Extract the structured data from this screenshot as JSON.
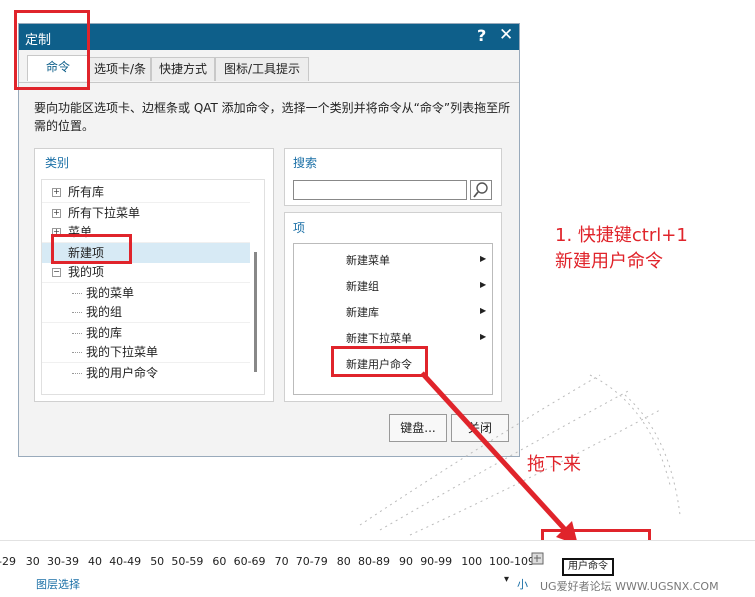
{
  "dialog": {
    "title": "定制",
    "help": "?",
    "close": "✕",
    "tabs": [
      "命令",
      "选项卡/条",
      "快捷方式",
      "图标/工具提示"
    ],
    "description": "要向功能区选项卡、边框条或 QAT 添加命令，选择一个类别并将命令从“命令”列表拖至所需的位置。",
    "category_title": "类别",
    "category_tree": [
      {
        "label": "所有库",
        "level": 0,
        "expander": "+"
      },
      {
        "label": "所有下拉菜单",
        "level": 0,
        "expander": "+"
      },
      {
        "label": "菜单",
        "level": 0,
        "expander": "+"
      },
      {
        "label": "新建项",
        "level": 0,
        "expander": ""
      },
      {
        "label": "我的项",
        "level": 0,
        "expander": "−"
      },
      {
        "label": "我的菜单",
        "level": 1,
        "expander": ""
      },
      {
        "label": "我的组",
        "level": 1,
        "expander": ""
      },
      {
        "label": "我的库",
        "level": 1,
        "expander": ""
      },
      {
        "label": "我的下拉菜单",
        "level": 1,
        "expander": ""
      },
      {
        "label": "我的用户命令",
        "level": 1,
        "expander": ""
      }
    ],
    "search_title": "搜索",
    "search_value": "",
    "items_title": "项",
    "items": [
      "新建菜单",
      "新建组",
      "新建库",
      "新建下拉菜单",
      "新建用户命令"
    ],
    "items_arrow": "▶",
    "keyboard_button": "键盘...",
    "close_button": "关闭"
  },
  "annotations": {
    "step1_line1": "1. 快捷键ctrl+1",
    "step1_line2": "新建用户命令",
    "drag": "拖下来"
  },
  "bottom": {
    "ranges": [
      "-29",
      "30",
      "30-39",
      "40",
      "40-49",
      "50",
      "50-59",
      "60",
      "60-69",
      "70",
      "70-79",
      "80",
      "80-89",
      "90",
      "90-99",
      "100",
      "100-109"
    ],
    "layer_select": "图层选择",
    "dropdown_glyph": "▾",
    "small": "小",
    "user_command_label": "用户命令",
    "watermark": "UG爱好者论坛 WWW.UGSNX.COM"
  },
  "colors": {
    "accent": "#0e5f8a",
    "annotation": "#e0242b",
    "selected": "#d7eaf5"
  }
}
